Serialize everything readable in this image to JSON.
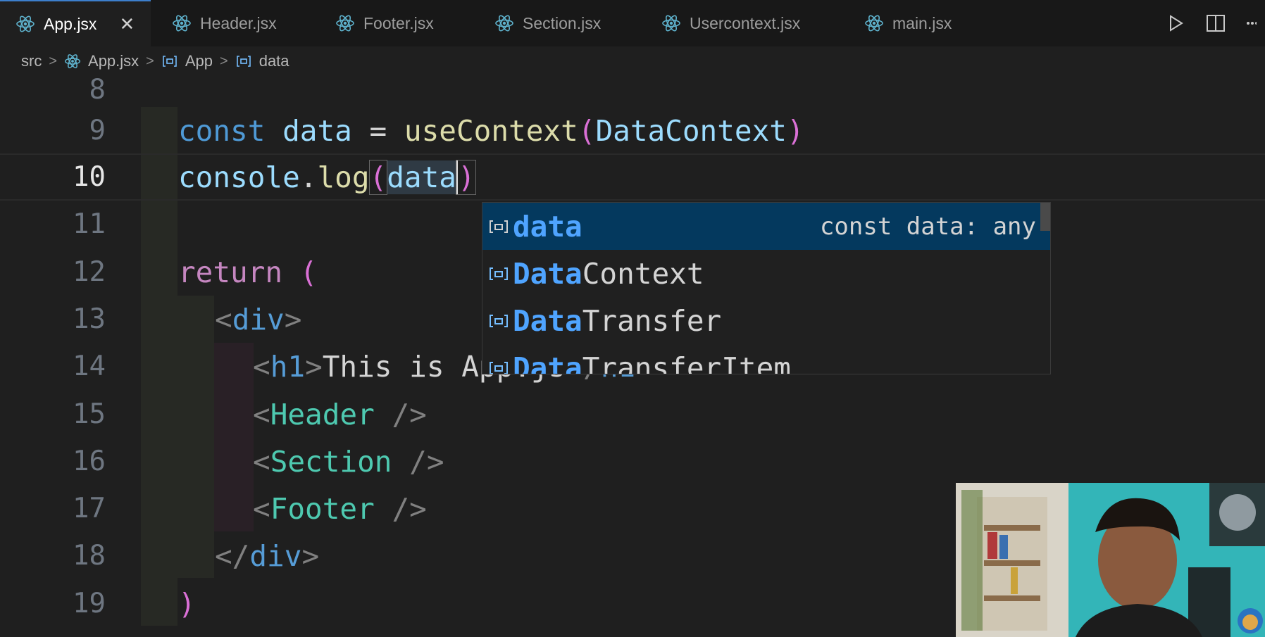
{
  "tabs": [
    {
      "label": "App.jsx",
      "active": true
    },
    {
      "label": "Header.jsx"
    },
    {
      "label": "Footer.jsx"
    },
    {
      "label": "Section.jsx"
    },
    {
      "label": "Usercontext.jsx"
    },
    {
      "label": "main.jsx"
    }
  ],
  "tab_close": "✕",
  "breadcrumb": {
    "root": "src",
    "file": "App.jsx",
    "fn": "App",
    "sym": "data",
    "sep": ">"
  },
  "line_numbers": [
    "8",
    "9",
    "10",
    "11",
    "12",
    "13",
    "14",
    "15",
    "16",
    "17",
    "18",
    "19"
  ],
  "code": {
    "l9": {
      "kw": "const",
      "var": "data",
      "eq": "=",
      "fn": "useContext",
      "open": "(",
      "arg": "DataContext",
      "close": ")"
    },
    "l10": {
      "obj": "console",
      "dot": ".",
      "fn": "log",
      "open": "(",
      "arg": "data",
      "close": ")"
    },
    "l12": {
      "kw": "return",
      "open": "("
    },
    "l13": {
      "lt": "<",
      "tag": "div",
      "gt": ">"
    },
    "l14": {
      "lt": "<",
      "tag": "h1",
      "gt": ">",
      "text": "This is App.js",
      "close_lt": "</",
      "close_tag": "h1",
      "close_gt": ">"
    },
    "l15": {
      "lt": "<",
      "cmp": "Header",
      "end": "/>"
    },
    "l16": {
      "lt": "<",
      "cmp": "Section",
      "end": "/>"
    },
    "l17": {
      "lt": "<",
      "cmp": "Footer",
      "end": "/>"
    },
    "l18": {
      "lt": "</",
      "tag": "div",
      "gt": ">"
    },
    "l19": {
      "close": ")"
    }
  },
  "suggestions": [
    {
      "match": "data",
      "rest": "",
      "detail": "const data: any",
      "selected": true
    },
    {
      "match": "Data",
      "rest": "Context"
    },
    {
      "match": "Data",
      "rest": "Transfer"
    },
    {
      "match": "Data",
      "rest": "TransferItem"
    }
  ],
  "colors": {
    "accent": "#3c7fcc",
    "selection": "#04395e",
    "keyword": "#569cd6",
    "control": "#c586c0",
    "component": "#4ec9b0"
  }
}
